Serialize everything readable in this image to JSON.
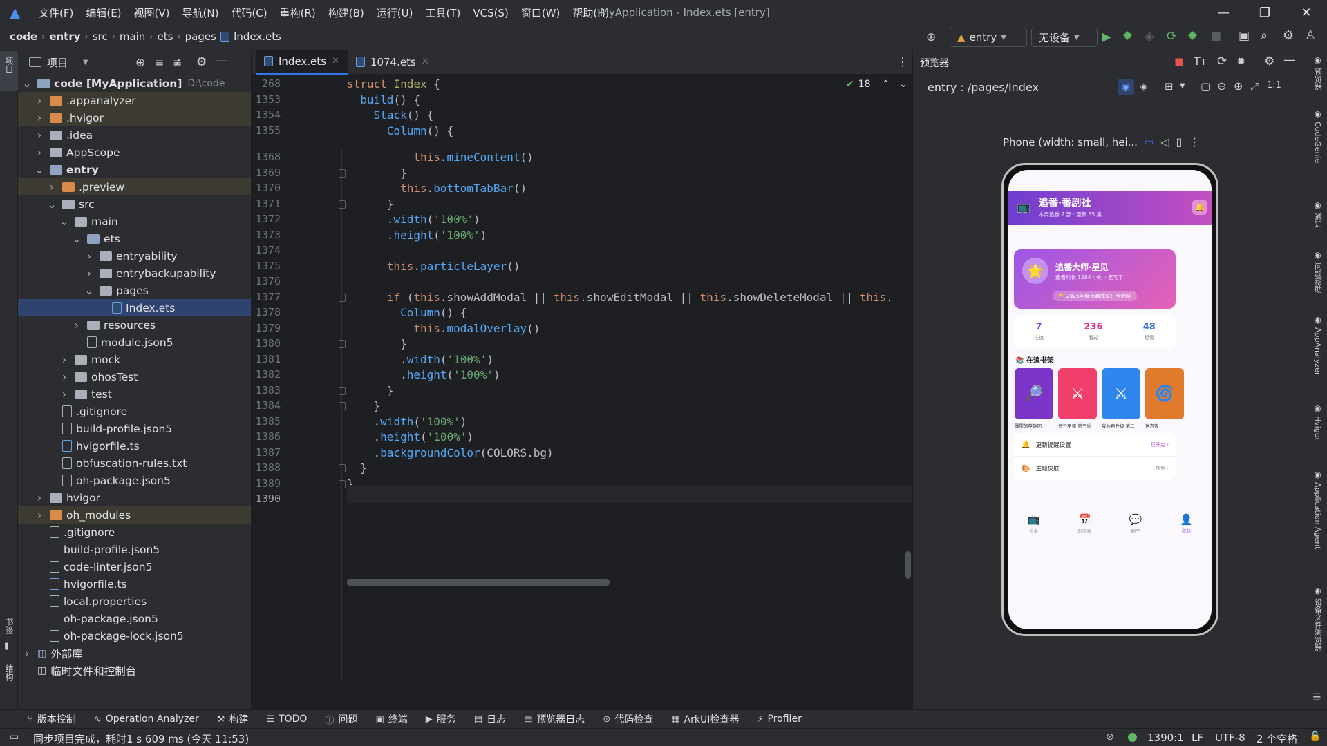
{
  "titlebar": {
    "menus": [
      "文件(F)",
      "编辑(E)",
      "视图(V)",
      "导航(N)",
      "代码(C)",
      "重构(R)",
      "构建(B)",
      "运行(U)",
      "工具(T)",
      "VCS(S)",
      "窗口(W)",
      "帮助(H)"
    ],
    "window_title": "MyApplication - Index.ets [entry]"
  },
  "breadcrumb": [
    "code",
    "entry",
    "src",
    "main",
    "ets",
    "pages",
    "Index.ets"
  ],
  "toolbar": {
    "module": "entry",
    "device": "无设备"
  },
  "project": {
    "title": "项目",
    "tree": [
      {
        "depth": 0,
        "arrow": "v",
        "icon": "fold-blue",
        "label": "code [MyApplication]",
        "suffix": "D:\\code",
        "bold": true,
        "hl": ""
      },
      {
        "depth": 1,
        "arrow": ">",
        "icon": "fold-orange",
        "label": ".appanalyzer",
        "hl": "ex"
      },
      {
        "depth": 1,
        "arrow": ">",
        "icon": "fold-orange",
        "label": ".hvigor",
        "hl": "ex"
      },
      {
        "depth": 1,
        "arrow": ">",
        "icon": "fold-gray",
        "label": ".idea",
        "hl": ""
      },
      {
        "depth": 1,
        "arrow": ">",
        "icon": "fold-gray",
        "label": "AppScope",
        "hl": ""
      },
      {
        "depth": 1,
        "arrow": "v",
        "icon": "fold-blue",
        "label": "entry",
        "bold": true,
        "hl": ""
      },
      {
        "depth": 2,
        "arrow": ">",
        "icon": "fold-orange",
        "label": ".preview",
        "hl": "ex"
      },
      {
        "depth": 2,
        "arrow": "v",
        "icon": "fold-gray",
        "label": "src",
        "hl": ""
      },
      {
        "depth": 3,
        "arrow": "v",
        "icon": "fold-gray",
        "label": "main",
        "hl": ""
      },
      {
        "depth": 4,
        "arrow": "v",
        "icon": "fold-blue",
        "label": "ets",
        "hl": ""
      },
      {
        "depth": 5,
        "arrow": ">",
        "icon": "fold-gray",
        "label": "entryability",
        "hl": ""
      },
      {
        "depth": 5,
        "arrow": ">",
        "icon": "fold-gray",
        "label": "entrybackupability",
        "hl": ""
      },
      {
        "depth": 5,
        "arrow": "v",
        "icon": "fold-gray",
        "label": "pages",
        "hl": ""
      },
      {
        "depth": 6,
        "arrow": "",
        "icon": "file-ets",
        "label": "Index.ets",
        "hl": "sel"
      },
      {
        "depth": 4,
        "arrow": ">",
        "icon": "fold-gray",
        "label": "resources",
        "hl": ""
      },
      {
        "depth": 4,
        "arrow": "",
        "icon": "file",
        "label": "module.json5",
        "hl": ""
      },
      {
        "depth": 3,
        "arrow": ">",
        "icon": "fold-gray",
        "label": "mock",
        "hl": ""
      },
      {
        "depth": 3,
        "arrow": ">",
        "icon": "fold-gray",
        "label": "ohosTest",
        "hl": ""
      },
      {
        "depth": 3,
        "arrow": ">",
        "icon": "fold-gray",
        "label": "test",
        "hl": ""
      },
      {
        "depth": 2,
        "arrow": "",
        "icon": "file",
        "label": ".gitignore",
        "hl": ""
      },
      {
        "depth": 2,
        "arrow": "",
        "icon": "file",
        "label": "build-profile.json5",
        "hl": ""
      },
      {
        "depth": 2,
        "arrow": "",
        "icon": "file-ts",
        "label": "hvigorfile.ts",
        "hl": ""
      },
      {
        "depth": 2,
        "arrow": "",
        "icon": "file",
        "label": "obfuscation-rules.txt",
        "hl": ""
      },
      {
        "depth": 2,
        "arrow": "",
        "icon": "file",
        "label": "oh-package.json5",
        "hl": ""
      },
      {
        "depth": 1,
        "arrow": ">",
        "icon": "fold-gray",
        "label": "hvigor",
        "hl": ""
      },
      {
        "depth": 1,
        "arrow": ">",
        "icon": "fold-orange",
        "label": "oh_modules",
        "hl": "ex"
      },
      {
        "depth": 1,
        "arrow": "",
        "icon": "file",
        "label": ".gitignore",
        "hl": ""
      },
      {
        "depth": 1,
        "arrow": "",
        "icon": "file",
        "label": "build-profile.json5",
        "hl": ""
      },
      {
        "depth": 1,
        "arrow": "",
        "icon": "file",
        "label": "code-linter.json5",
        "hl": ""
      },
      {
        "depth": 1,
        "arrow": "",
        "icon": "file-ts",
        "label": "hvigorfile.ts",
        "hl": ""
      },
      {
        "depth": 1,
        "arrow": "",
        "icon": "file",
        "label": "local.properties",
        "hl": ""
      },
      {
        "depth": 1,
        "arrow": "",
        "icon": "file",
        "label": "oh-package.json5",
        "hl": ""
      },
      {
        "depth": 1,
        "arrow": "",
        "icon": "file",
        "label": "oh-package-lock.json5",
        "hl": ""
      },
      {
        "depth": 0,
        "arrow": ">",
        "icon": "lib",
        "label": "外部库",
        "hl": ""
      },
      {
        "depth": 0,
        "arrow": "",
        "icon": "scratch",
        "label": "临时文件和控制台",
        "hl": ""
      }
    ]
  },
  "editor": {
    "tabs": [
      "Index.ets",
      "1074.ets"
    ],
    "inspection_count": "18",
    "sticky": [
      {
        "ln": "268",
        "html": "<span class='kw'>struct</span> <span class='typ'>Index</span> {"
      },
      {
        "ln": "1353",
        "html": "  <span class='fn'>build</span>() {"
      },
      {
        "ln": "1354",
        "html": "    <span class='fn'>Stack</span>() {"
      },
      {
        "ln": "1355",
        "html": "      <span class='fn'>Column</span>() {"
      }
    ],
    "lines": [
      {
        "ln": "1368",
        "html": "          <span class='th'>this</span>.<span class='fn'>mineContent</span>()"
      },
      {
        "ln": "1369",
        "html": "        }"
      },
      {
        "ln": "1370",
        "html": "        <span class='th'>this</span>.<span class='fn'>bottomTabBar</span>()"
      },
      {
        "ln": "1371",
        "html": "      }"
      },
      {
        "ln": "1372",
        "html": "      .<span class='fn'>width</span>(<span class='str'>'100%'</span>)"
      },
      {
        "ln": "1373",
        "html": "      .<span class='fn'>height</span>(<span class='str'>'100%'</span>)"
      },
      {
        "ln": "1374",
        "html": ""
      },
      {
        "ln": "1375",
        "html": "      <span class='th'>this</span>.<span class='fn'>particleLayer</span>()"
      },
      {
        "ln": "1376",
        "html": ""
      },
      {
        "ln": "1377",
        "html": "      <span class='kw'>if</span> (<span class='th'>this</span>.showAddModal || <span class='th'>this</span>.showEditModal || <span class='th'>this</span>.showDeleteModal || <span class='th'>this</span>."
      },
      {
        "ln": "1378",
        "html": "        <span class='fn'>Column</span>() {"
      },
      {
        "ln": "1379",
        "html": "          <span class='th'>this</span>.<span class='fn'>modalOverlay</span>()"
      },
      {
        "ln": "1380",
        "html": "        }"
      },
      {
        "ln": "1381",
        "html": "        .<span class='fn'>width</span>(<span class='str'>'100%'</span>)"
      },
      {
        "ln": "1382",
        "html": "        .<span class='fn'>height</span>(<span class='str'>'100%'</span>)"
      },
      {
        "ln": "1383",
        "html": "      }"
      },
      {
        "ln": "1384",
        "html": "    }"
      },
      {
        "ln": "1385",
        "html": "    .<span class='fn'>width</span>(<span class='str'>'100%'</span>)"
      },
      {
        "ln": "1386",
        "html": "    .<span class='fn'>height</span>(<span class='str'>'100%'</span>)"
      },
      {
        "ln": "1387",
        "html": "    .<span class='fn'>backgroundColor</span>(COLORS.bg)"
      },
      {
        "ln": "1388",
        "html": "  }"
      },
      {
        "ln": "1389",
        "html": "}"
      },
      {
        "ln": "1390",
        "html": ""
      }
    ]
  },
  "preview": {
    "title": "预览器",
    "route": "entry : /pages/Index",
    "device_label": "Phone (width: small, hei...",
    "app": {
      "header_title": "追番·番剧社",
      "header_sub": "本周追番 7 部 · 更新 35 集",
      "profile_name": "追番大师·星见",
      "profile_sub": "追番时长 1284 小时 · 老宅了",
      "badge": "🏆 2025年度追番成就：全勤奖",
      "stats": [
        {
          "num": "7",
          "label": "在追",
          "color": "#7b3fe4"
        },
        {
          "num": "236",
          "label": "看过",
          "color": "#e0358c"
        },
        {
          "num": "48",
          "label": "想看",
          "color": "#3b6fe0"
        }
      ],
      "shelf_title": "📚 在追书架",
      "shelf": [
        {
          "title": "霹雳的英雄团",
          "color": "#7a35c8",
          "glyph": "🔎"
        },
        {
          "title": "元气巫师 第三季",
          "color": "#ef3f6a",
          "glyph": "⚔"
        },
        {
          "title": "我独自升级 第二",
          "color": "#2f86ee",
          "glyph": "⚔"
        },
        {
          "title": "迷宫饭",
          "color": "#e07a2c",
          "glyph": "🌀"
        }
      ],
      "settings": [
        {
          "icon": "🔔",
          "label": "更新提醒设置",
          "value": "已开启 ›"
        },
        {
          "icon": "🎨",
          "label": "主题皮肤",
          "value": "樱紫 ›"
        }
      ],
      "tabs": [
        {
          "icon": "📺",
          "label": "追番",
          "active": false
        },
        {
          "icon": "📅",
          "label": "时间表",
          "active": false
        },
        {
          "icon": "💬",
          "label": "圈子",
          "active": false
        },
        {
          "icon": "👤",
          "label": "我的",
          "active": true
        }
      ]
    }
  },
  "left_strip": {
    "top": "项目",
    "bottom1": "书签",
    "bottom2": "结构"
  },
  "right_strip": [
    "预览器",
    "CodeGenie",
    "通知",
    "问题帮助",
    "AppAnalyzer",
    "Hvigor",
    "Application Agent",
    "设备文件浏览器"
  ],
  "toolwindows": [
    "版本控制",
    "Operation Analyzer",
    "构建",
    "TODO",
    "问题",
    "终端",
    "服务",
    "日志",
    "预览器日志",
    "代码检查",
    "ArkUI检查器",
    "Profiler"
  ],
  "status": {
    "message": "同步项目完成，耗时1 s 609 ms (今天 11:53)",
    "position": "1390:1",
    "line_sep": "LF",
    "encoding": "UTF-8",
    "indent": "2 个空格"
  }
}
